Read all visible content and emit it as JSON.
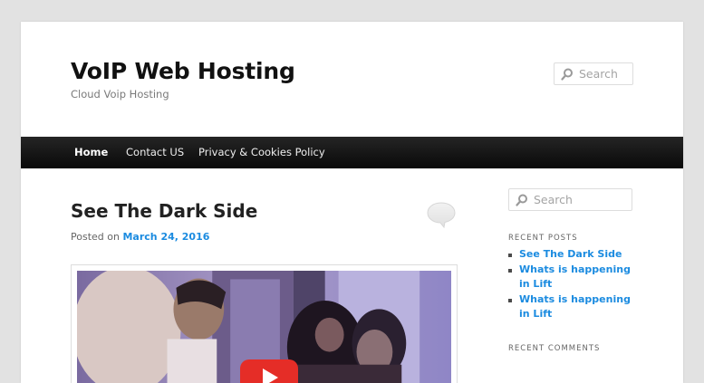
{
  "site": {
    "title": "VoIP Web Hosting",
    "description": "Cloud Voip Hosting"
  },
  "header_search": {
    "placeholder": "Search",
    "icon": "search-icon"
  },
  "nav": {
    "items": [
      {
        "label": "Home",
        "current": true
      },
      {
        "label": "Contact US",
        "current": false
      },
      {
        "label": "Privacy & Cookies Policy",
        "current": false
      }
    ]
  },
  "post": {
    "title": "See The Dark Side",
    "posted_on_label": "Posted on",
    "date": "March 24, 2016",
    "video_icon": "youtube-play-icon"
  },
  "sidebar": {
    "search_placeholder": "Search",
    "recent_posts_title": "Recent Posts",
    "recent_posts": [
      {
        "title": "See The Dark Side"
      },
      {
        "title": "Whats is happening in Lift"
      },
      {
        "title": "Whats is happening in Lift"
      }
    ],
    "recent_comments_title": "Recent Comments"
  },
  "colors": {
    "background": "#e2e2e2",
    "page": "#ffffff",
    "nav": "#111111",
    "link": "#1b8be0",
    "play_button": "#e52d27"
  }
}
